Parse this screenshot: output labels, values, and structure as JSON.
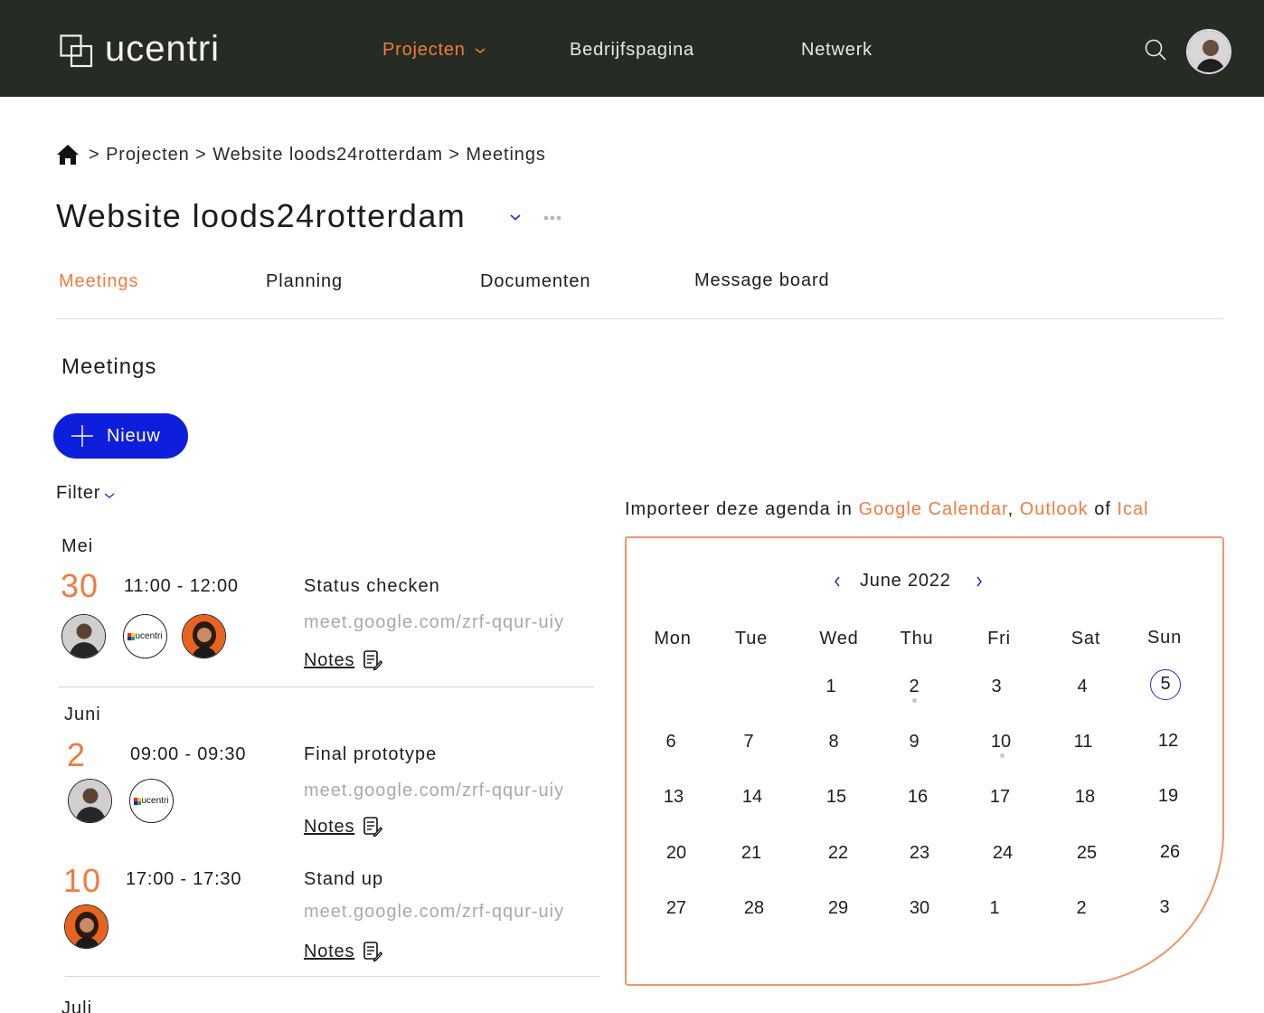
{
  "brand": {
    "name": "ucentri"
  },
  "nav": {
    "items": [
      {
        "label": "Projecten",
        "active": true,
        "has_dropdown": true
      },
      {
        "label": "Bedrijfspagina",
        "active": false
      },
      {
        "label": "Netwerk",
        "active": false
      }
    ],
    "search_icon": "search-icon",
    "avatar": "user-avatar"
  },
  "breadcrumb": {
    "home_icon": "home-icon",
    "items": [
      "Projecten",
      "Website loods24rotterdam",
      "Meetings"
    ],
    "separator": ">"
  },
  "project": {
    "title": "Website loods24rotterdam"
  },
  "tabs": [
    {
      "label": "Meetings",
      "active": true
    },
    {
      "label": "Planning",
      "active": false
    },
    {
      "label": "Documenten",
      "active": false
    },
    {
      "label": "Message board",
      "active": false
    }
  ],
  "section": {
    "title": "Meetings"
  },
  "new_button": {
    "label": "Nieuw"
  },
  "filter": {
    "label": "Filter"
  },
  "meetings": [
    {
      "month": "Mei",
      "day": "30",
      "time": "11:00 - 12:00",
      "title": "Status checken",
      "link": "meet.google.com/zrf-qqur-uiy",
      "notes": "Notes",
      "participants": [
        "person",
        "ucentri",
        "person"
      ]
    },
    {
      "month": "Juni",
      "day": "2",
      "time": "09:00 - 09:30",
      "title": "Final prototype",
      "link": "meet.google.com/zrf-qqur-uiy",
      "notes": "Notes",
      "participants": [
        "person",
        "ucentri"
      ]
    },
    {
      "month": "",
      "day": "10",
      "time": "17:00 - 17:30",
      "title": "Stand up",
      "link": "meet.google.com/zrf-qqur-uiy",
      "notes": "Notes",
      "participants": [
        "person"
      ]
    },
    {
      "month": "Juli"
    }
  ],
  "import": {
    "prefix": "Importeer deze agenda in ",
    "google": "Google Calendar",
    "comma": ",",
    "outlook": "Outlook",
    "of": "of",
    "ical": "Ical"
  },
  "calendar": {
    "month_label": "June 2022",
    "weekdays": [
      "Mon",
      "Tue",
      "Wed",
      "Thu",
      "Fri",
      "Sat",
      "Sun"
    ],
    "weeks": [
      [
        "",
        "",
        "1",
        "2",
        "3",
        "4",
        "5"
      ],
      [
        "6",
        "7",
        "8",
        "9",
        "10",
        "11",
        "12"
      ],
      [
        "13",
        "14",
        "15",
        "16",
        "17",
        "18",
        "19"
      ],
      [
        "20",
        "21",
        "22",
        "23",
        "24",
        "25",
        "26"
      ],
      [
        "27",
        "28",
        "29",
        "30",
        "1",
        "2",
        "3"
      ]
    ],
    "today": "5",
    "event_days": [
      "2",
      "10"
    ],
    "colors": {
      "accent": "#f07b3f",
      "primary": "#0e1fdc",
      "nav_bg": "#262b24"
    }
  }
}
